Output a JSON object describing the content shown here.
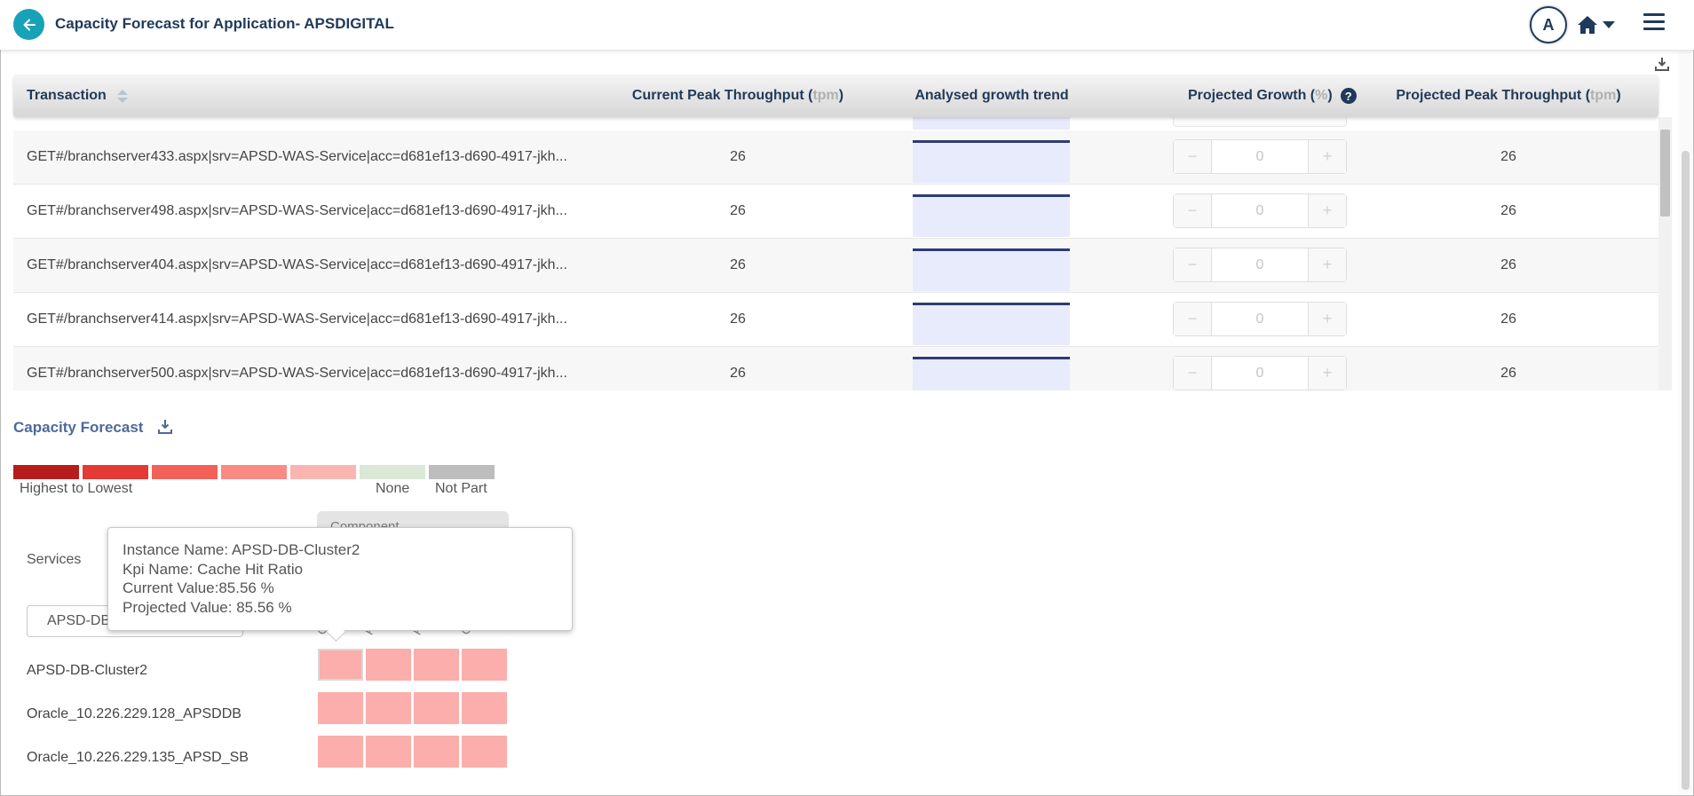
{
  "header": {
    "title": "Capacity Forecast for Application- APSDIGITAL",
    "avatar_initial": "A"
  },
  "table": {
    "columns": {
      "transaction": "Transaction",
      "current_peak": "Current Peak Throughput (",
      "current_peak_unit": "tpm",
      "growth_trend": "Analysed growth trend",
      "projected_growth": "Projected Growth (",
      "projected_growth_unit": "%",
      "projected_peak": "Projected Peak Throughput (",
      "projected_peak_unit": "tpm",
      "paren_close": ")"
    },
    "rows": [
      {
        "transaction": "GET#/branchserver433.aspx|srv=APSD-WAS-Service|acc=d681ef13-d690-4917-jkh...",
        "current": "26",
        "growth": "0",
        "projected": "26"
      },
      {
        "transaction": "GET#/branchserver498.aspx|srv=APSD-WAS-Service|acc=d681ef13-d690-4917-jkh...",
        "current": "26",
        "growth": "0",
        "projected": "26"
      },
      {
        "transaction": "GET#/branchserver404.aspx|srv=APSD-WAS-Service|acc=d681ef13-d690-4917-jkh...",
        "current": "26",
        "growth": "0",
        "projected": "26"
      },
      {
        "transaction": "GET#/branchserver414.aspx|srv=APSD-WAS-Service|acc=d681ef13-d690-4917-jkh...",
        "current": "26",
        "growth": "0",
        "projected": "26"
      },
      {
        "transaction": "GET#/branchserver500.aspx|srv=APSD-WAS-Service|acc=d681ef13-d690-4917-jkh...",
        "current": "26",
        "growth": "0",
        "projected": "26"
      }
    ],
    "stepper_minus": "−",
    "stepper_plus": "+"
  },
  "capacity": {
    "title": "Capacity Forecast",
    "legend": {
      "colors": [
        "#b71c1c",
        "#e53935",
        "#f26157",
        "#f98b84",
        "#fbb5b1",
        "#dbe8d6",
        "#bdbdbd"
      ],
      "highest_label": "Highest to Lowest",
      "none_label": "None",
      "notpart_label": "Not Part"
    },
    "component_tab": "Component",
    "services_label": "Services",
    "service_select": "APSD-DB-Cluster2",
    "column_initials": [
      "C",
      "P",
      "P",
      "C"
    ],
    "heatmap_color": "#fbaeab",
    "instances": [
      "APSD-DB-Cluster2",
      "Oracle_10.226.229.128_APSDDB",
      "Oracle_10.226.229.135_APSD_SB"
    ]
  },
  "tooltip": {
    "instance": "Instance Name: APSD-DB-Cluster2",
    "kpi": "Kpi Name: Cache Hit Ratio",
    "current": "Current Value:85.56 %",
    "projected": "Projected Value: 85.56 %"
  },
  "icons": [
    "arrow-left-icon",
    "home-icon",
    "caret-down-icon",
    "menu-icon",
    "download-icon",
    "sort-icon",
    "question-icon"
  ]
}
